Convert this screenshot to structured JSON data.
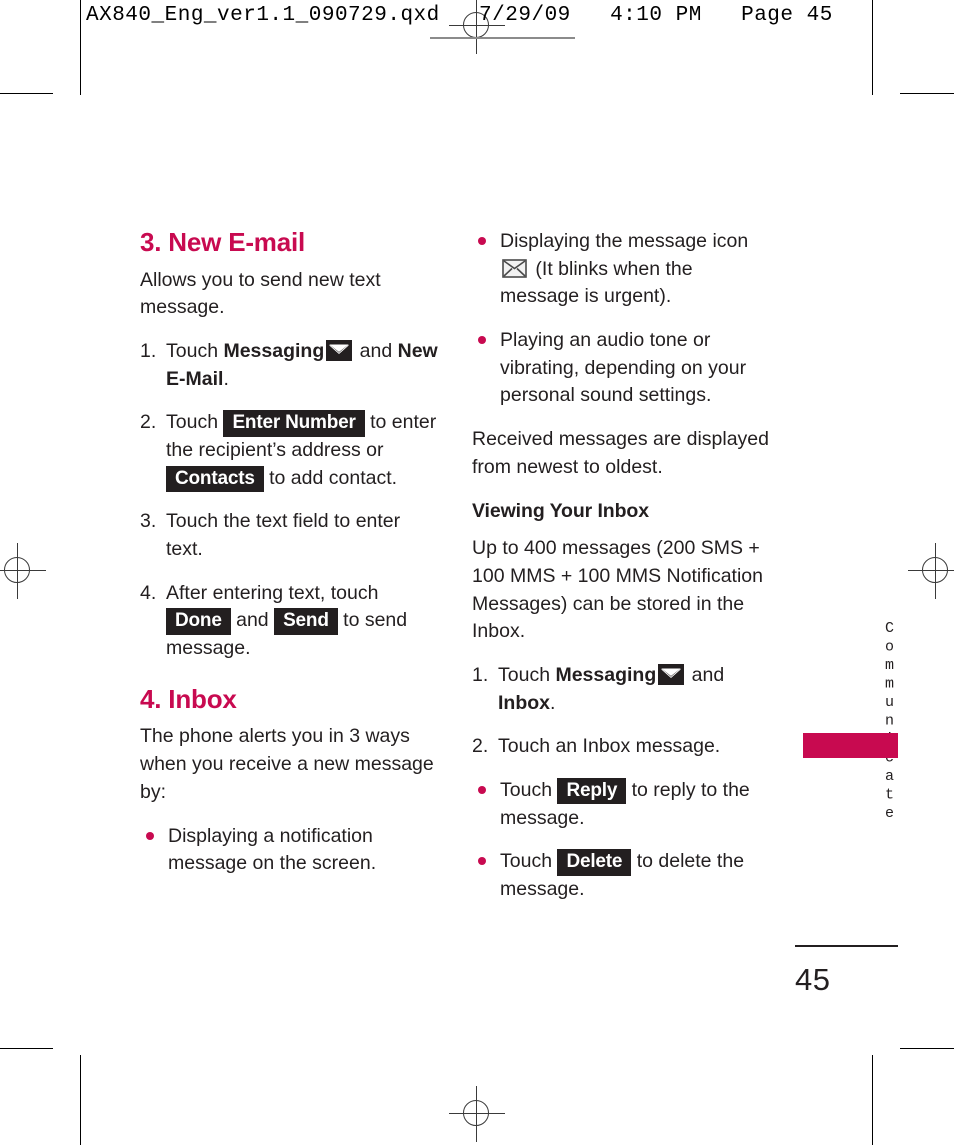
{
  "print_marks": {
    "slug": "AX840_Eng_ver1.1_090729.qxd   7/29/09   4:10 PM   Page 45"
  },
  "theme": {
    "accent": "#c80a50",
    "ink": "#231f20",
    "key_bg": "#231f20",
    "key_fg": "#ffffff"
  },
  "left_column": {
    "heading_new_email": "3. New E-mail",
    "intro": "Allows you to send new text message.",
    "step1": {
      "marker": "1.",
      "a": "Touch ",
      "bold1": "Messaging",
      "icon": "envelope-solid-icon",
      "b": " and ",
      "bold2": "New E-Mail",
      "c": "."
    },
    "step2": {
      "marker": "2.",
      "a": "Touch ",
      "key1": "Enter Number",
      "b": " to enter the recipient’s address or ",
      "key2": "Contacts",
      "c": " to add contact."
    },
    "step3": {
      "marker": "3.",
      "a": "Touch the text field to enter text."
    },
    "step4": {
      "marker": "4.",
      "a": "After entering text, touch ",
      "key1": "Done",
      "b": " and ",
      "key2": "Send",
      "c": " to send message."
    },
    "heading_inbox": "4. Inbox",
    "inbox_intro": "The phone alerts you in 3 ways when you receive a new message by:",
    "bullet1": "Displaying a notification message on the screen."
  },
  "right_column": {
    "bullet_icon": {
      "a": "Displaying the message icon ",
      "icon": "envelope-outline-icon",
      "b": " (It blinks when the message is urgent)."
    },
    "bullet_audio": "Playing an audio tone or vibrating, depending on your personal sound settings.",
    "received_note": "Received messages are displayed from newest to oldest.",
    "subheading_viewing": "Viewing Your Inbox",
    "capacity": "Up to 400 messages (200 SMS + 100 MMS + 100 MMS Notification Messages) can be stored in the Inbox.",
    "step1": {
      "marker": "1.",
      "a": "Touch ",
      "bold1": "Messaging",
      "icon": "envelope-solid-icon",
      "b": " and ",
      "bold2": "Inbox",
      "c": "."
    },
    "step2": {
      "marker": "2.",
      "a": "Touch an Inbox message."
    },
    "bullet_reply": {
      "a": "Touch ",
      "key": "Reply",
      "b": " to reply to the message."
    },
    "bullet_delete": {
      "a": "Touch ",
      "key": "Delete",
      "b": " to delete the message."
    }
  },
  "side_tab": {
    "label": "Communicate"
  },
  "folio": {
    "page_number": "45"
  }
}
